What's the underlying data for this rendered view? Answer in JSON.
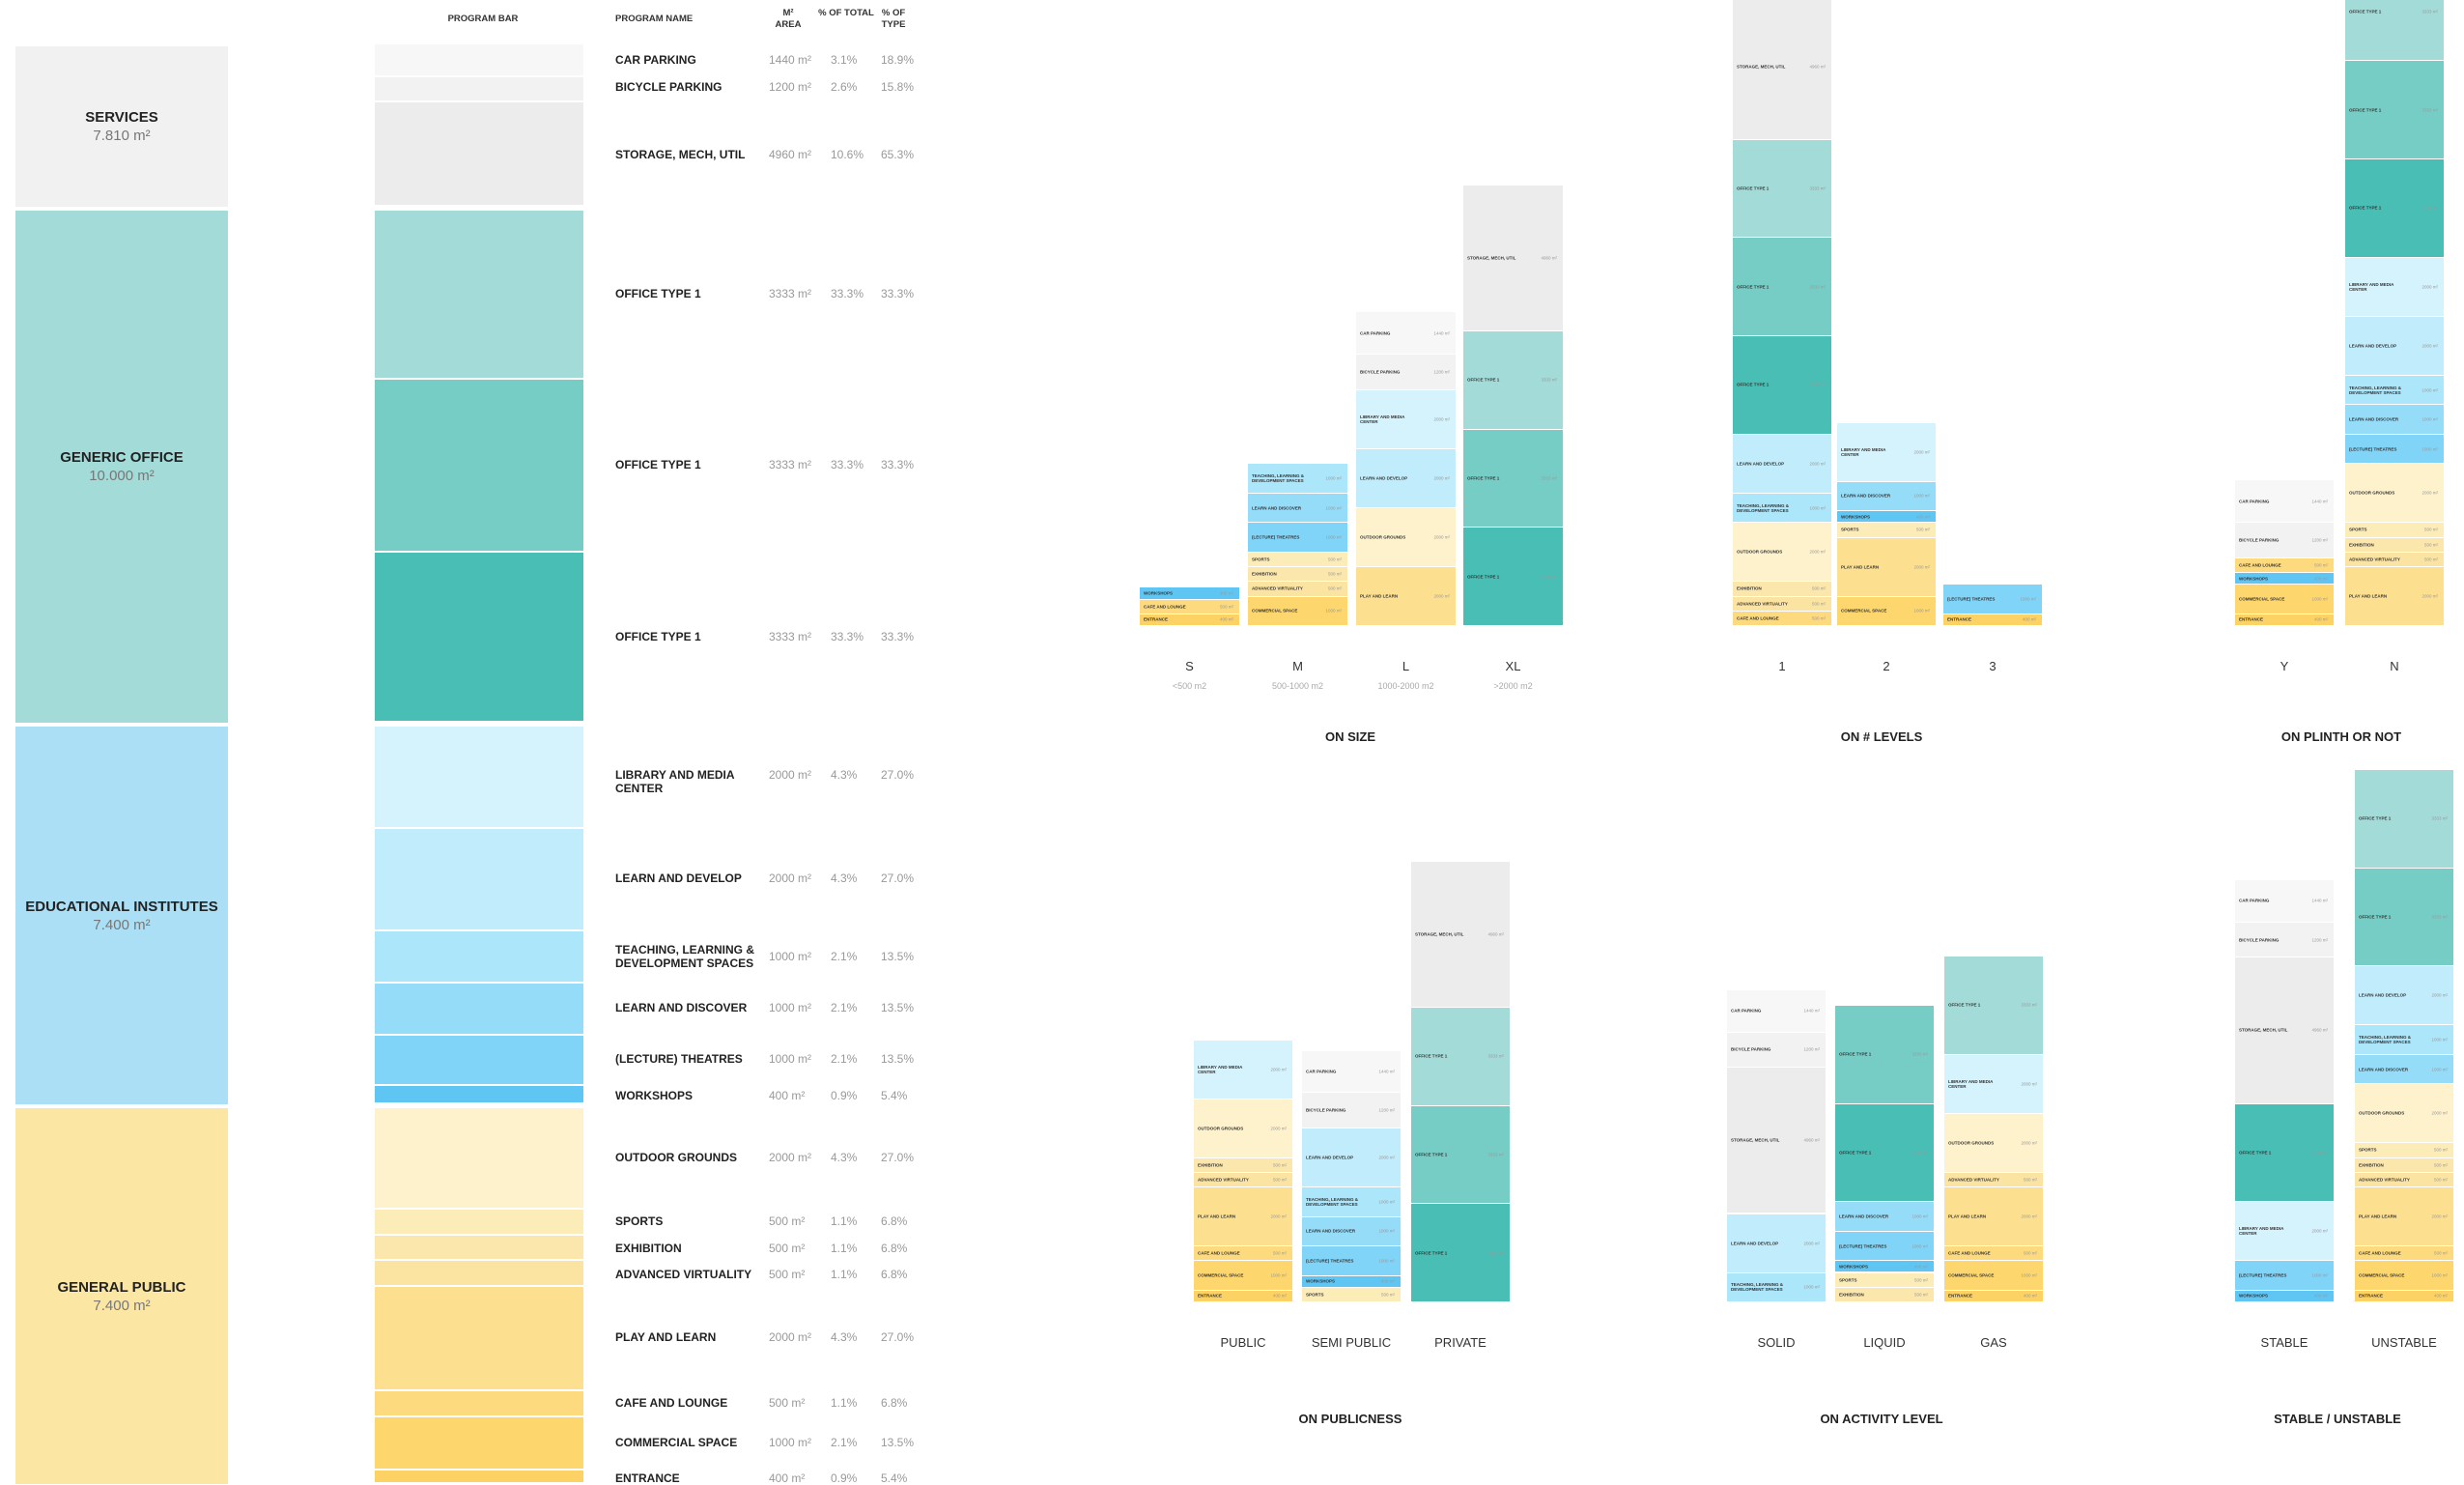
{
  "headers": {
    "program_bar": "PROGRAM BAR",
    "program_name": "PROGRAM NAME",
    "area": "M² AREA",
    "pct_total": "% OF TOTAL",
    "pct_type": "% OF TYPE"
  },
  "categories": [
    {
      "name": "SERVICES",
      "area": "7.810 m²",
      "color": "#f0f1f0"
    },
    {
      "name": "GENERIC OFFICE",
      "area": "10.000 m²",
      "color": "#a3dbd8"
    },
    {
      "name": "EDUCATIONAL INSTITUTES",
      "area": "7.400 m²",
      "color": "#aadff5"
    },
    {
      "name": "GENERAL PUBLIC",
      "area": "7.400 m²",
      "color": "#fbe7a3"
    }
  ],
  "programs": [
    {
      "key": "car",
      "name": "CAR PARKING",
      "area": "1440 m²",
      "pct_total": "3.1%",
      "pct_type": "18.9%",
      "color": "#f7f7f7",
      "short": "CAR PARKING"
    },
    {
      "key": "bike",
      "name": "BICYCLE PARKING",
      "area": "1200 m²",
      "pct_total": "2.6%",
      "pct_type": "15.8%",
      "color": "#f2f2f2",
      "short": "BICYCLE PARKING"
    },
    {
      "key": "storage",
      "name": "STORAGE, MECH, UTIL",
      "area": "4960 m²",
      "pct_total": "10.6%",
      "pct_type": "65.3%",
      "color": "#ececec",
      "short": "STORAGE, MECH, UTIL"
    },
    {
      "key": "off1",
      "name": "OFFICE TYPE 1",
      "area": "3333 m²",
      "pct_total": "33.3%",
      "pct_type": "33.3%",
      "color": "#a3dbd8",
      "short": "OFFICE TYPE 1"
    },
    {
      "key": "off2",
      "name": "OFFICE TYPE 1",
      "area": "3333 m²",
      "pct_total": "33.3%",
      "pct_type": "33.3%",
      "color": "#76cdc6",
      "short": "OFFICE TYPE 1"
    },
    {
      "key": "off3",
      "name": "OFFICE TYPE 1",
      "area": "3333 m²",
      "pct_total": "33.3%",
      "pct_type": "33.3%",
      "color": "#49beb5",
      "short": "OFFICE TYPE 1"
    },
    {
      "key": "lib",
      "name": "LIBRARY AND MEDIA CENTER",
      "area": "2000 m²",
      "pct_total": "4.3%",
      "pct_type": "27.0%",
      "color": "#d4f3fc",
      "short": "LIBRARY AND MEDIA CENTER"
    },
    {
      "key": "ld",
      "name": "LEARN AND DEVELOP",
      "area": "2000 m²",
      "pct_total": "4.3%",
      "pct_type": "27.0%",
      "color": "#c0ecfb",
      "short": "LEARN AND DEVELOP"
    },
    {
      "key": "tl",
      "name": "TEACHING, LEARNING & DEVELOPMENT SPACES",
      "area": "1000 m²",
      "pct_total": "2.1%",
      "pct_type": "13.5%",
      "color": "#ace6fa",
      "short": "TEACHING, LEARNING & DEVELOPMENT SPACES"
    },
    {
      "key": "ldisc",
      "name": "LEARN AND DISCOVER",
      "area": "1000 m²",
      "pct_total": "2.1%",
      "pct_type": "13.5%",
      "color": "#95dcf9",
      "short": "LEARN AND DISCOVER"
    },
    {
      "key": "lect",
      "name": "(LECTURE) THEATRES",
      "area": "1000 m²",
      "pct_total": "2.1%",
      "pct_type": "13.5%",
      "color": "#80d4f8",
      "short": "(LECTURE) THEATRES"
    },
    {
      "key": "work",
      "name": "WORKSHOPS",
      "area": "400 m²",
      "pct_total": "0.9%",
      "pct_type": "5.4%",
      "color": "#5fc6f4",
      "short": "WORKSHOPS"
    },
    {
      "key": "out",
      "name": "OUTDOOR GROUNDS",
      "area": "2000 m²",
      "pct_total": "4.3%",
      "pct_type": "27.0%",
      "color": "#fdf2cc",
      "short": "OUTDOOR GROUNDS"
    },
    {
      "key": "sport",
      "name": "SPORTS",
      "area": "500 m²",
      "pct_total": "1.1%",
      "pct_type": "6.8%",
      "color": "#fcecb8",
      "short": "SPORTS"
    },
    {
      "key": "exh",
      "name": "EXHIBITION",
      "area": "500 m²",
      "pct_total": "1.1%",
      "pct_type": "6.8%",
      "color": "#fbe6ac",
      "short": "EXHIBITION"
    },
    {
      "key": "adv",
      "name": "ADVANCED   VIRTUALITY",
      "area": "500 m²",
      "pct_total": "1.1%",
      "pct_type": "6.8%",
      "color": "#fbe3a2",
      "short": "ADVANCED VIRTUALITY"
    },
    {
      "key": "play",
      "name": "PLAY AND LEARN",
      "area": "2000 m²",
      "pct_total": "4.3%",
      "pct_type": "27.0%",
      "color": "#fde08f",
      "short": "PLAY AND LEARN"
    },
    {
      "key": "cafe",
      "name": "CAFE AND LOUNGE",
      "area": "500 m²",
      "pct_total": "1.1%",
      "pct_type": "6.8%",
      "color": "#fdda7e",
      "short": "CAFE AND LOUNGE"
    },
    {
      "key": "comm",
      "name": "COMMERCIAL SPACE",
      "area": "1000 m²",
      "pct_total": "2.1%",
      "pct_type": "13.5%",
      "color": "#fdd66e",
      "short": "COMMERCIAL SPACE"
    },
    {
      "key": "ent",
      "name": "ENTRANCE",
      "area": "400 m²",
      "pct_total": "0.9%",
      "pct_type": "5.4%",
      "color": "#fdd264",
      "short": "ENTRANCE"
    }
  ],
  "diagrams": [
    {
      "title": "ON SIZE",
      "columns": [
        {
          "label": "S",
          "range": "<500 m2",
          "stack": [
            "work",
            "cafe",
            "ent"
          ]
        },
        {
          "label": "M",
          "range": "500-1000 m2",
          "stack": [
            "tl",
            "ldisc",
            "lect",
            "sport",
            "exh",
            "adv",
            "comm"
          ]
        },
        {
          "label": "L",
          "range": "1000-2000 m2",
          "stack": [
            "car",
            "bike",
            "lib",
            "ld",
            "out",
            "play"
          ]
        },
        {
          "label": "XL",
          "range": ">2000 m2",
          "stack": [
            "storage",
            "off1",
            "off2",
            "off3"
          ]
        }
      ]
    },
    {
      "title": "ON # LEVELS",
      "columns": [
        {
          "label": "1",
          "range": "",
          "stack": [
            "car",
            "bike",
            "storage",
            "off1",
            "off2",
            "off3",
            "ld",
            "tl",
            "out",
            "exh",
            "adv",
            "cafe"
          ]
        },
        {
          "label": "2",
          "range": "",
          "stack": [
            "lib",
            "ldisc",
            "work",
            "sport",
            "play",
            "comm"
          ]
        },
        {
          "label": "3",
          "range": "",
          "stack": [
            "lect",
            "ent"
          ]
        }
      ]
    },
    {
      "title": "ON PLINTH OR NOT",
      "columns": [
        {
          "label": "Y",
          "range": "",
          "stack": [
            "car",
            "bike",
            "cafe",
            "work",
            "comm",
            "ent"
          ]
        },
        {
          "label": "N",
          "range": "",
          "stack": [
            "storage",
            "off1",
            "off2",
            "off3",
            "lib",
            "ld",
            "tl",
            "ldisc",
            "lect",
            "out",
            "sport",
            "exh",
            "adv",
            "play"
          ]
        }
      ]
    },
    {
      "title": "ON PUBLICNESS",
      "columns": [
        {
          "label": "PUBLIC",
          "range": "",
          "stack": [
            "lib",
            "out",
            "exh",
            "adv",
            "play",
            "cafe",
            "comm",
            "ent"
          ]
        },
        {
          "label": "SEMI PUBLIC",
          "range": "",
          "stack": [
            "car",
            "bike",
            "ld",
            "tl",
            "ldisc",
            "lect",
            "work",
            "sport"
          ]
        },
        {
          "label": "PRIVATE",
          "range": "",
          "stack": [
            "storage",
            "off1",
            "off2",
            "off3"
          ]
        }
      ]
    },
    {
      "title": "ON ACTIVITY LEVEL",
      "columns": [
        {
          "label": "SOLID",
          "range": "",
          "stack": [
            "car",
            "bike",
            "storage",
            "ld",
            "tl"
          ]
        },
        {
          "label": "LIQUID",
          "range": "",
          "stack": [
            "off2",
            "off3",
            "ldisc",
            "lect",
            "work",
            "sport",
            "exh"
          ]
        },
        {
          "label": "GAS",
          "range": "",
          "stack": [
            "off1",
            "lib",
            "out",
            "adv",
            "play",
            "cafe",
            "comm",
            "ent"
          ]
        }
      ]
    },
    {
      "title": "STABLE / UNSTABLE",
      "columns": [
        {
          "label": "STABLE",
          "range": "",
          "stack": [
            "car",
            "bike",
            "storage",
            "off3",
            "lib",
            "lect",
            "work"
          ]
        },
        {
          "label": "UNSTABLE",
          "range": "",
          "stack": [
            "off1",
            "off2",
            "ld",
            "tl",
            "ldisc",
            "out",
            "sport",
            "exh",
            "adv",
            "play",
            "cafe",
            "comm",
            "ent"
          ]
        }
      ]
    }
  ]
}
